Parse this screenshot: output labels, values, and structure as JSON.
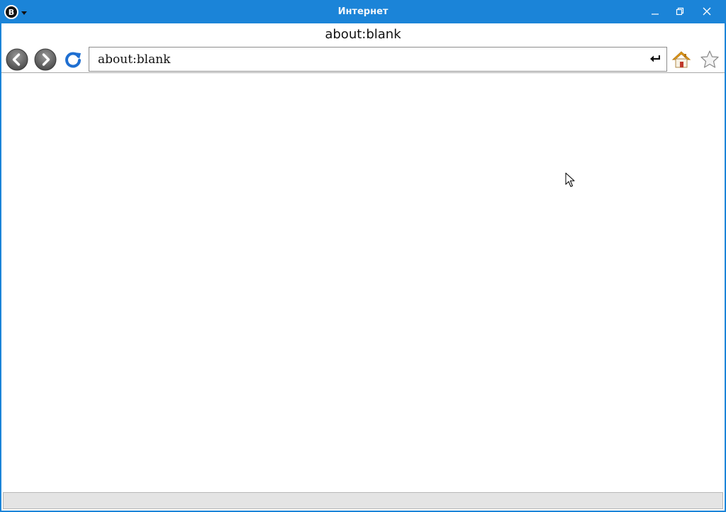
{
  "window": {
    "title": "Интернет",
    "accent_color": "#1b84d8",
    "system_menu_icon": "system-logo-icon"
  },
  "page": {
    "title": "about:blank"
  },
  "navbar": {
    "url_value": "about:blank",
    "icons": [
      "back-arrow-icon",
      "forward-arrow-icon",
      "reload-icon",
      "go-enter-icon",
      "home-icon",
      "star-icon"
    ]
  },
  "statusbar": {
    "text": ""
  }
}
